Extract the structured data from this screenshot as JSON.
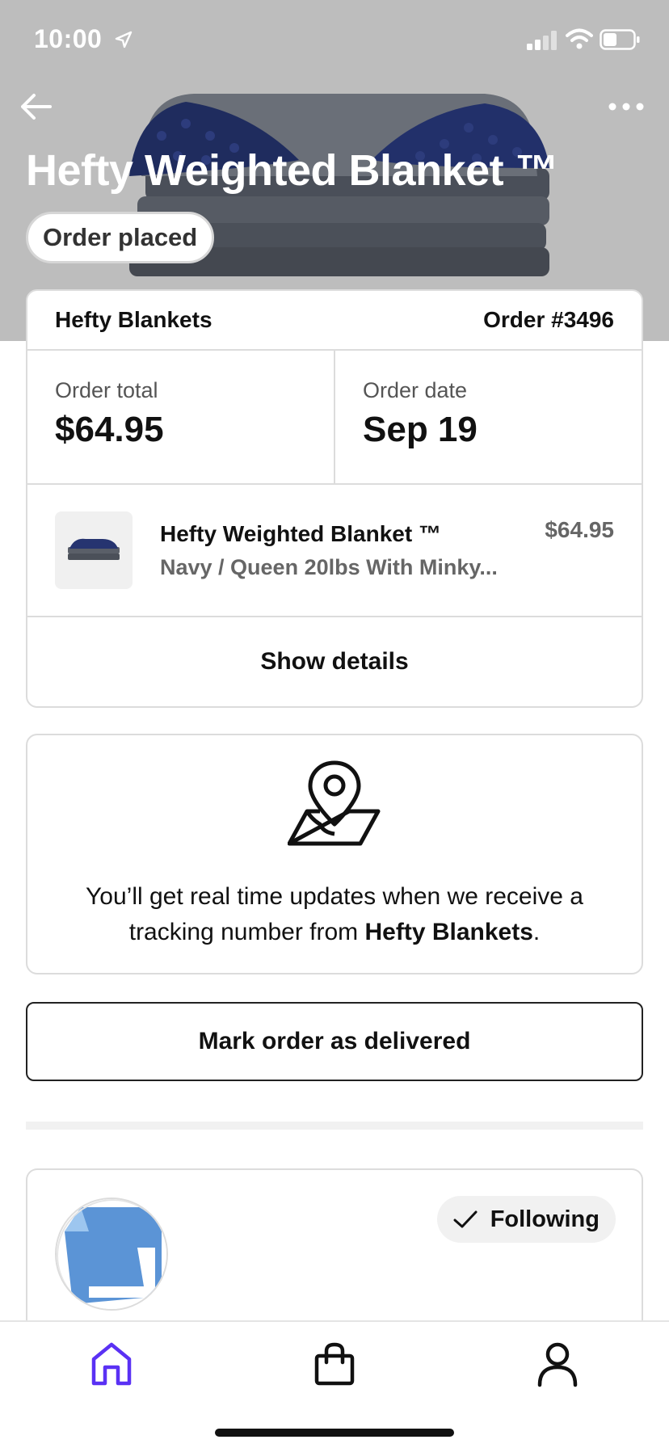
{
  "status_bar": {
    "time": "10:00",
    "icons": [
      "location-arrow-icon",
      "cellular-signal-icon",
      "wifi-icon",
      "battery-icon"
    ]
  },
  "header": {
    "title": "Hefty Weighted Blanket ™",
    "status": "Order placed",
    "back_icon": "back-arrow-icon",
    "more_icon": "more-dots-icon"
  },
  "order": {
    "store": "Hefty Blankets",
    "number": "Order #3496",
    "total_label": "Order total",
    "total_value": "$64.95",
    "date_label": "Order date",
    "date_value": "Sep 19",
    "item": {
      "name": "Hefty Weighted Blanket ™",
      "variant": "Navy / Queen 20lbs With Minky...",
      "price": "$64.95"
    },
    "show_details_label": "Show details"
  },
  "tracking": {
    "icon": "map-pin-icon",
    "text_prefix": "You’ll get real time updates when we receive a tracking number from ",
    "store": "Hefty Blankets",
    "text_suffix": "."
  },
  "actions": {
    "mark_delivered_label": "Mark order as delivered"
  },
  "shop": {
    "follow_label": "Following",
    "follow_icon": "checkmark-icon"
  },
  "nav": {
    "items": [
      "home-icon",
      "shopping-bag-icon",
      "profile-icon"
    ],
    "active": "home",
    "active_color": "#5a31f4"
  }
}
